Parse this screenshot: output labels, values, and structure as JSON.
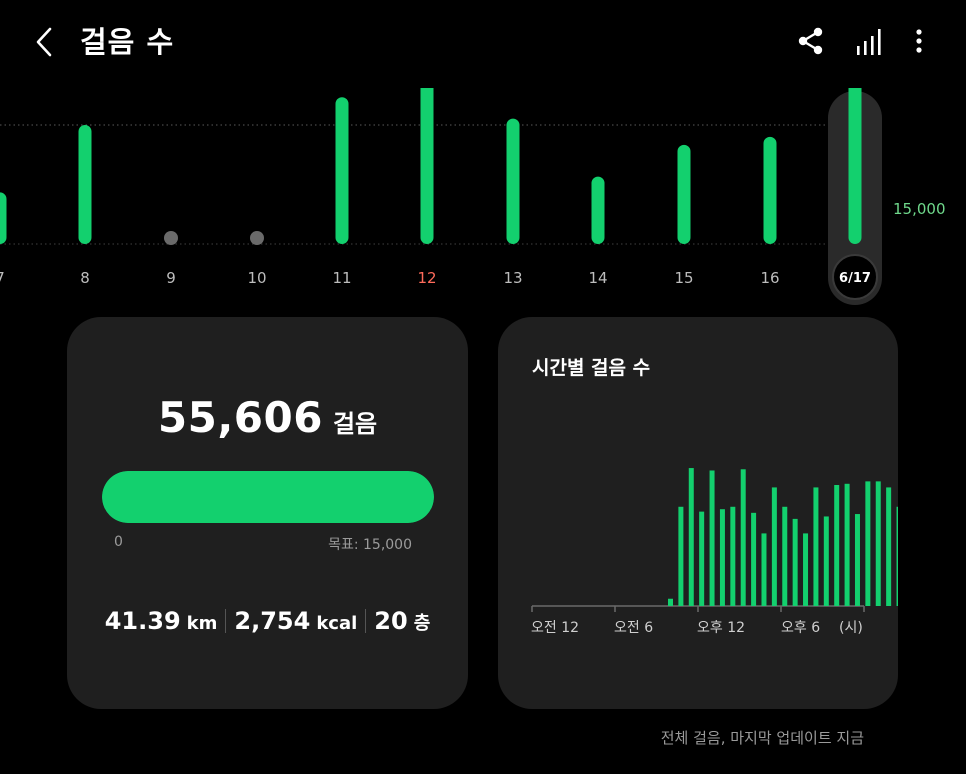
{
  "header": {
    "title": "걸음 수",
    "icons": [
      "back-arrow-icon",
      "share-icon",
      "bar-chart-icon",
      "more-vertical-icon"
    ]
  },
  "daily_chart": {
    "days": [
      "7",
      "8",
      "9",
      "10",
      "11",
      "12",
      "13",
      "14",
      "15",
      "16",
      "6/17"
    ],
    "steps": [
      6500,
      15000,
      0,
      0,
      18500,
      21000,
      15800,
      8500,
      12500,
      13500,
      23000
    ],
    "highlight_day": "12",
    "selected_day": "6/17",
    "goal_label": "15,000",
    "goal_value": 15000,
    "colors": {
      "bar": "#13d06e",
      "highlight_text": "#ff6b5b",
      "goal_text": "#6fd88b"
    }
  },
  "summary": {
    "steps": "55,606",
    "steps_unit": "걸음",
    "progress_fraction": 1.0,
    "progress_min": "0",
    "progress_goal": "목표: 15,000",
    "distance": "41.39",
    "distance_unit": "km",
    "calories": "2,754",
    "calories_unit": "kcal",
    "floors": "20",
    "floors_unit": "층"
  },
  "hourly": {
    "title": "시간별 걸음 수",
    "tick_labels": [
      "오전 12",
      "오전 6",
      "오후 12",
      "오후 6",
      "(시)"
    ],
    "bars": [
      {
        "t": 10,
        "v": 0.06
      },
      {
        "t": 10.75,
        "v": 0.82
      },
      {
        "t": 11.5,
        "v": 1.14
      },
      {
        "t": 12.25,
        "v": 0.78
      },
      {
        "t": 13,
        "v": 1.12
      },
      {
        "t": 13.75,
        "v": 0.8
      },
      {
        "t": 14.5,
        "v": 0.82
      },
      {
        "t": 15.25,
        "v": 1.13
      },
      {
        "t": 16,
        "v": 0.77
      },
      {
        "t": 16.75,
        "v": 0.6
      },
      {
        "t": 17.5,
        "v": 0.98
      },
      {
        "t": 18.25,
        "v": 0.82
      },
      {
        "t": 19,
        "v": 0.72
      },
      {
        "t": 19.75,
        "v": 0.6
      },
      {
        "t": 20.5,
        "v": 0.98
      },
      {
        "t": 21.25,
        "v": 0.74
      },
      {
        "t": 22,
        "v": 1.0
      },
      {
        "t": 22.75,
        "v": 1.01
      },
      {
        "t": 23.5,
        "v": 0.76
      },
      {
        "t": 24.25,
        "v": 1.03
      },
      {
        "t": 25,
        "v": 1.03
      },
      {
        "t": 25.75,
        "v": 0.98
      },
      {
        "t": 26.5,
        "v": 0.82
      },
      {
        "t": 29.5,
        "v": 0.06
      },
      {
        "t": 30.25,
        "v": 0.06
      },
      {
        "t": 31.5,
        "v": 0.06
      }
    ]
  },
  "footer": {
    "note": "전체 걸음, 마지막 업데이트 지금"
  }
}
